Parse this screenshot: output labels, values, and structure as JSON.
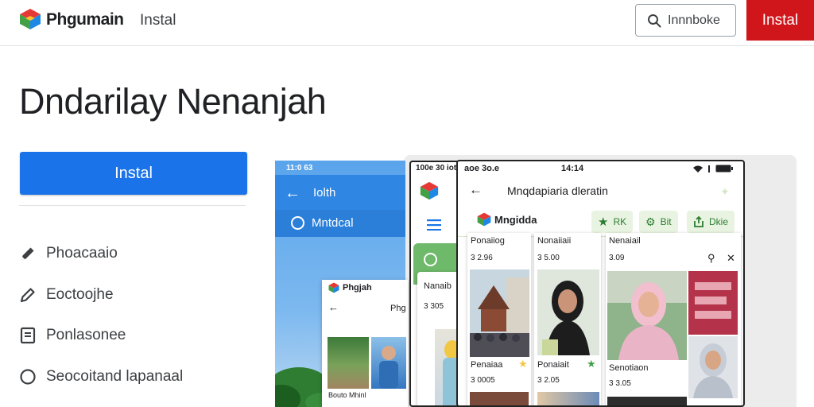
{
  "header": {
    "brand": "Phgumain",
    "nav_label": "Instal",
    "search_label": "Innnboke",
    "install_label": "Instal"
  },
  "main": {
    "title": "Dndarilay Nenanjah",
    "install_label": "Instal",
    "side_items": [
      {
        "icon": "pencil-icon",
        "label": "Phoacaaio"
      },
      {
        "icon": "edit-icon",
        "label": "Eoctoojhe"
      },
      {
        "icon": "document-icon",
        "label": "Ponlasonee"
      },
      {
        "icon": "circle-icon",
        "label": "Seocoitand lapanaal"
      }
    ]
  },
  "mockups": {
    "blue_phone": {
      "status": "11:0 63",
      "title": "Iolth",
      "tab_label": "Mntdcal"
    },
    "small_card": {
      "brand": "Phgjah",
      "label": "Phg",
      "footer": "Bouto Mhinl"
    },
    "mid_phone": {
      "status": "100e 30 iote",
      "card_name": "Nanaib",
      "card_count": "3 305"
    },
    "front_phone": {
      "status_left": "aoe 3o.e",
      "status_center": "14:14",
      "title": "Mnqdapiaria dleratin",
      "brand": "Mngidda",
      "chips": [
        {
          "icon": "star-icon",
          "label": "RK"
        },
        {
          "icon": "settings-icon",
          "label": "Bit"
        },
        {
          "icon": "share-icon",
          "label": "Dkie"
        }
      ],
      "cards": [
        {
          "name": "Ponaiiog",
          "count": "3 2.96",
          "name2": "Penaiaa",
          "count2": "3 0005"
        },
        {
          "name": "Nonaiiaii",
          "count": "3 5.00",
          "name2": "Ponaiait",
          "count2": "3 2.05"
        },
        {
          "name": "Nenaiail",
          "count": "3.09",
          "name2": "Senotiaon",
          "count2": "3 3.05"
        }
      ]
    }
  },
  "colors": {
    "accent_blue": "#1a73e8",
    "install_red": "#d0161b"
  }
}
